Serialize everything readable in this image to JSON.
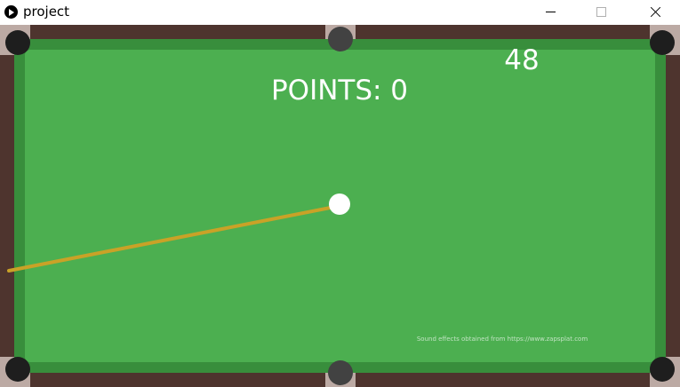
{
  "window": {
    "title": "project"
  },
  "hud": {
    "points_label": "POINTS: 0",
    "timer": "48",
    "credit": "Sound effects obtained from https://www.zapsplat.com"
  },
  "colors": {
    "felt": "#4caf50",
    "cushion": "#388e3c",
    "rail": "#4e342e",
    "pocket_liner": "#bcaaa4",
    "pocket": "#1e1e1e",
    "side_pocket": "#424242",
    "cue": "#c9a227",
    "cue_ball": "#ffffff"
  },
  "icons": {
    "app": "play-circle-icon",
    "minimize": "minimize-icon",
    "maximize": "maximize-icon",
    "close": "close-icon"
  }
}
